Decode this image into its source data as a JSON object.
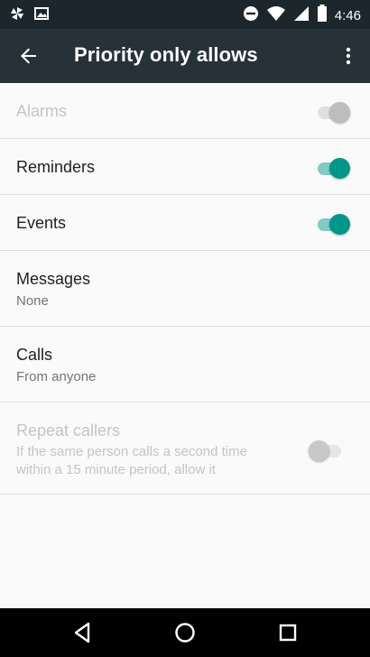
{
  "status_bar": {
    "time": "4:46",
    "left_icons": [
      "pinwheel-icon",
      "image-icon"
    ],
    "right_icons": [
      "do-not-disturb-icon",
      "wifi-icon",
      "signal-icon",
      "battery-icon"
    ]
  },
  "toolbar": {
    "title": "Priority only allows",
    "back_icon": "back-arrow-icon",
    "menu_icon": "more-vert-icon",
    "background": "#263238"
  },
  "settings": {
    "alarms": {
      "label": "Alarms",
      "enabled": false,
      "checked": true
    },
    "reminders": {
      "label": "Reminders",
      "enabled": true,
      "checked": true
    },
    "events": {
      "label": "Events",
      "enabled": true,
      "checked": true
    },
    "messages": {
      "label": "Messages",
      "value": "None"
    },
    "calls": {
      "label": "Calls",
      "value": "From anyone"
    },
    "repeat_callers": {
      "label": "Repeat callers",
      "summary_line1": "If the same person calls a second time",
      "summary_line2": "within a 15 minute period, allow it",
      "enabled": false,
      "checked": false
    }
  },
  "accent_color": "#009688",
  "nav_bar": {
    "icons": [
      "back-triangle-icon",
      "home-circle-icon",
      "recents-square-icon"
    ]
  }
}
